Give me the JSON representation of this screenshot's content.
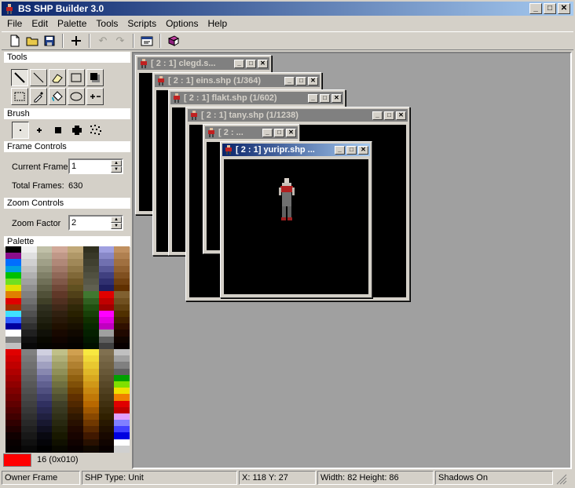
{
  "window": {
    "title": "BS SHP Builder 3.0"
  },
  "menu": [
    "File",
    "Edit",
    "Palette",
    "Tools",
    "Scripts",
    "Options",
    "Help"
  ],
  "toolbar_icons": [
    "new-file-icon",
    "open-folder-icon",
    "save-disk-icon",
    "add-plus-icon",
    "undo-icon",
    "redo-icon",
    "properties-icon",
    "book-icon"
  ],
  "panels": {
    "tools_header": "Tools",
    "brush_header": "Brush",
    "frame_header": "Frame Controls",
    "zoom_header": "Zoom Controls",
    "palette_header": "Palette"
  },
  "frame_controls": {
    "current_frame_label": "Current Frame",
    "current_frame_value": "1",
    "total_frames_label": "Total Frames:",
    "total_frames_value": "630"
  },
  "zoom_controls": {
    "zoom_factor_label": "Zoom Factor",
    "zoom_factor_value": "2"
  },
  "palette": {
    "selected_color": "#ff0000",
    "selected_label": "16 (0x010)"
  },
  "child_windows": [
    {
      "title": "[ 2 : 1] clegd.s..."
    },
    {
      "title": "[ 2 : 1] eins.shp (1/364)"
    },
    {
      "title": "[ 2 : 1] flakt.shp (1/602)"
    },
    {
      "title": "[ 2 : 1] tany.shp (1/1238)"
    },
    {
      "title": "[ 2 : ..."
    },
    {
      "title": "[ 2 : 1] yuripr.shp ..."
    }
  ],
  "statusbar": {
    "owner": "Owner Frame",
    "shp_type": "SHP Type: Unit",
    "coords": "X: 118 Y: 27",
    "size": "Width: 82 Height: 86",
    "shadows": "Shadows On"
  }
}
